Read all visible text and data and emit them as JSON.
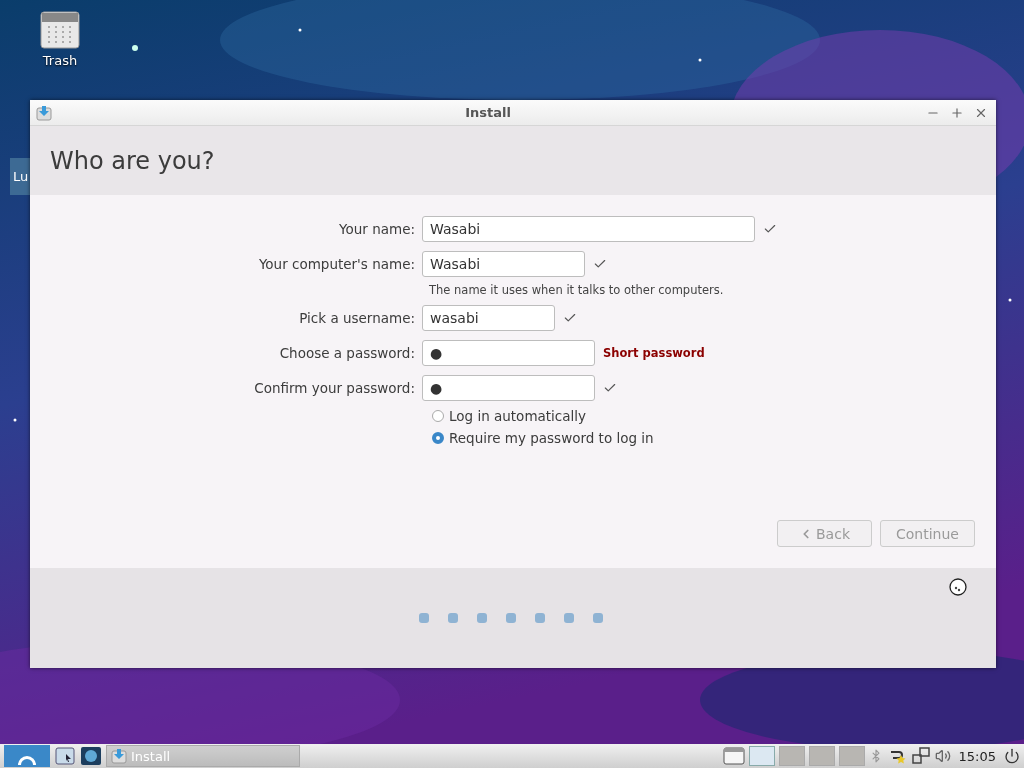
{
  "desktop": {
    "icons": [
      {
        "label": "Trash"
      }
    ],
    "hidden_label": "Lu"
  },
  "window": {
    "title": "Install",
    "heading": "Who are you?"
  },
  "fields": [
    {
      "label": "Your name:",
      "value": "Wasabi",
      "valid": true
    },
    {
      "label": "Your computer's name:",
      "value": "Wasabi",
      "valid": true,
      "hint": "The name it uses when it talks to other computers."
    },
    {
      "label": "Pick a username:",
      "value": "wasabi",
      "valid": true
    },
    {
      "label": "Choose a password:",
      "value": "●",
      "valid": false,
      "message": "Short password"
    },
    {
      "label": "Confirm your password:",
      "value": "●",
      "valid": true
    }
  ],
  "login_options": [
    {
      "label": "Log in automatically",
      "selected": false
    },
    {
      "label": "Require my password to log in",
      "selected": true
    }
  ],
  "buttons": [
    {
      "label": "Back",
      "kind": "back",
      "disabled": true
    },
    {
      "label": "Continue",
      "kind": "continue",
      "disabled": true
    }
  ],
  "taskbar": {
    "tasks": [
      {
        "label": "Install"
      }
    ],
    "workspaces": [
      {
        "selected": true
      },
      {
        "selected": false
      },
      {
        "selected": false
      },
      {
        "selected": false
      }
    ],
    "clock": "15:05"
  }
}
